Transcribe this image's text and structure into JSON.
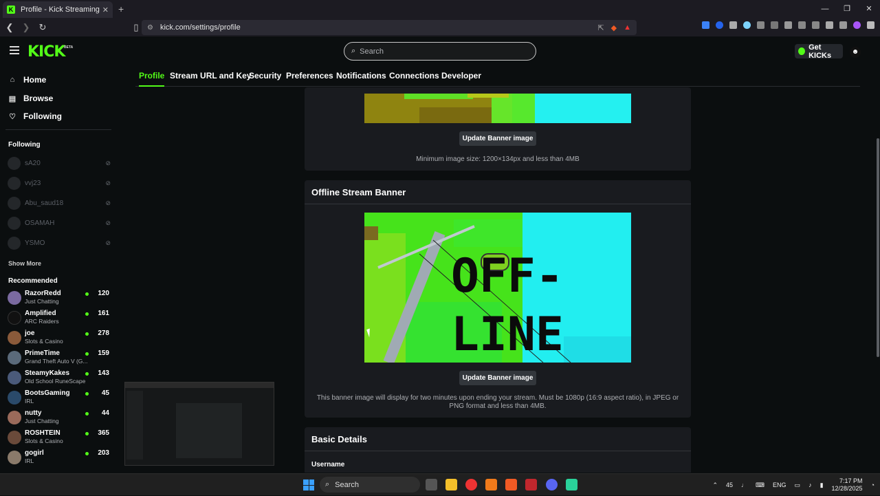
{
  "browser": {
    "tab_title": "Profile - Kick Streaming",
    "tab_close": "✕",
    "new_tab": "+",
    "url": "kick.com/settings/profile",
    "win_min": "—",
    "win_max": "❐",
    "win_close": "✕"
  },
  "header": {
    "logo": "KICK",
    "beta": "BETA",
    "search_placeholder": "Search",
    "get_kicks": "Get KICKs"
  },
  "sidebar": {
    "nav": [
      {
        "label": "Home",
        "icon": "home-icon"
      },
      {
        "label": "Browse",
        "icon": "browse-icon"
      },
      {
        "label": "Following",
        "icon": "heart-icon"
      }
    ],
    "following_title": "Following",
    "following": [
      {
        "name": "sA20"
      },
      {
        "name": "vvj23"
      },
      {
        "name": "Abu_saud18"
      },
      {
        "name": "OSAMAH"
      },
      {
        "name": "YSMO"
      }
    ],
    "show_more": "Show More",
    "recommended_title": "Recommended",
    "recommended": [
      {
        "name": "RazorRedd",
        "category": "Just Chatting",
        "viewers": "120"
      },
      {
        "name": "Amplified",
        "category": "ARC Raiders",
        "viewers": "161"
      },
      {
        "name": "joe",
        "category": "Slots & Casino",
        "viewers": "278"
      },
      {
        "name": "PrimeTime",
        "category": "Grand Theft Auto V (G...",
        "viewers": "159"
      },
      {
        "name": "SteamyKakes",
        "category": "Old School RuneScape",
        "viewers": "143"
      },
      {
        "name": "BootsGaming",
        "category": "IRL",
        "viewers": "45"
      },
      {
        "name": "nutty",
        "category": "Just Chatting",
        "viewers": "44"
      },
      {
        "name": "ROSHTEIN",
        "category": "Slots & Casino",
        "viewers": "365"
      },
      {
        "name": "gogirl",
        "category": "IRL",
        "viewers": "203"
      }
    ]
  },
  "settings_tabs": [
    "Profile",
    "Stream URL and Key",
    "Security",
    "Preferences",
    "Notifications",
    "Connections",
    "Developer"
  ],
  "banner_card": {
    "button": "Update Banner image",
    "hint": "Minimum image size: 1200×134px and less than 4MB"
  },
  "offline_card": {
    "title": "Offline Stream Banner",
    "image_text_line1": "OFF-",
    "image_text_line2": "LINE",
    "button": "Update Banner image",
    "hint_line1": "This banner image will display for two minutes upon ending your stream. Must be 1080p (16:9 aspect ratio), in JPEG or",
    "hint_line2": "PNG format and less than 4MB."
  },
  "basic_details": {
    "title": "Basic Details",
    "username_label": "Username"
  },
  "taskbar": {
    "search": "Search",
    "tray_badge": "45",
    "lang": "ENG",
    "time": "7:17 PM",
    "date": "12/28/2025"
  },
  "colors": {
    "accent": "#53fc18",
    "bg": "#0b0e0f",
    "card": "#191b1f"
  }
}
